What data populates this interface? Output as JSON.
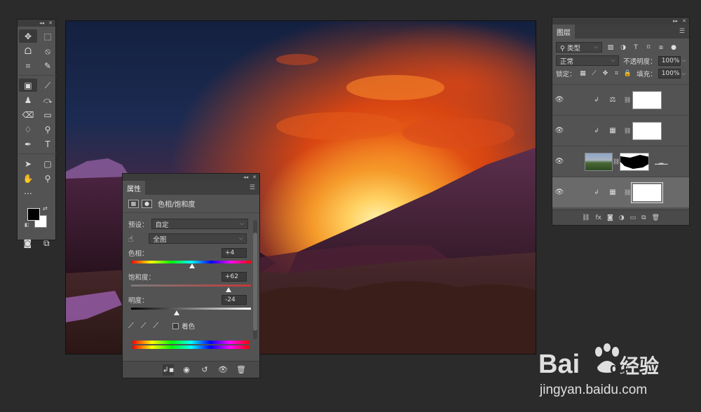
{
  "toolbar": {
    "tools": [
      {
        "name": "move-tool",
        "glyph": "✥",
        "selected": true
      },
      {
        "name": "marquee-tool",
        "glyph": "⬚"
      },
      {
        "name": "lasso-tool",
        "glyph": "ᗝ"
      },
      {
        "name": "quick-select-tool",
        "glyph": "⦸"
      },
      {
        "name": "crop-tool",
        "glyph": "⌗"
      },
      {
        "name": "eyedropper-tool",
        "glyph": "✎"
      },
      {
        "name": "patch-tool",
        "glyph": "▣",
        "selected": true
      },
      {
        "name": "brush-tool",
        "glyph": "⟋"
      },
      {
        "name": "stamp-tool",
        "glyph": "♟"
      },
      {
        "name": "history-brush-tool",
        "glyph": "⤼"
      },
      {
        "name": "eraser-tool",
        "glyph": "⌫"
      },
      {
        "name": "gradient-tool",
        "glyph": "▭"
      },
      {
        "name": "blur-tool",
        "glyph": "♢"
      },
      {
        "name": "dodge-tool",
        "glyph": "⚲"
      },
      {
        "name": "pen-tool",
        "glyph": "✒"
      },
      {
        "name": "type-tool",
        "glyph": "T"
      },
      {
        "name": "path-select-tool",
        "glyph": "➤"
      },
      {
        "name": "shape-tool",
        "glyph": "▢"
      },
      {
        "name": "hand-tool",
        "glyph": "✋"
      },
      {
        "name": "zoom-tool",
        "glyph": "⚲"
      },
      {
        "name": "more-tools",
        "glyph": "⋯"
      }
    ]
  },
  "properties": {
    "tab": "属性",
    "title": "色相/饱和度",
    "preset_label": "预设：",
    "preset_value": "自定",
    "channel_value": "全图",
    "hue_label": "色相：",
    "hue_value": "+4",
    "hue_pct": 0.51,
    "saturation_label": "饱和度：",
    "saturation_value": "+62",
    "saturation_pct": 0.81,
    "lightness_label": "明度：",
    "lightness_value": "-24",
    "lightness_pct": 0.38,
    "colorize_label": "着色"
  },
  "layers": {
    "tab": "图层",
    "filter_label": "类型",
    "blend_mode": "正常",
    "opacity_label": "不透明度：",
    "opacity_value": "100%",
    "lock_label": "锁定：",
    "fill_label": "填充：",
    "fill_value": "100%",
    "items": [
      {
        "adjustment": "balance-icon",
        "clipped": true,
        "selected": false
      },
      {
        "adjustment": "levels-icon",
        "clipped": true,
        "selected": false
      },
      {
        "adjustment": "image",
        "clipped": false,
        "selected": false
      },
      {
        "adjustment": "hue-sat-icon",
        "clipped": true,
        "selected": true
      }
    ]
  },
  "watermark": {
    "brand": "Bai",
    "brand_tail": "du",
    "suffix": "经验",
    "url": "jingyan.baidu.com"
  },
  "colors": {
    "panel": "#535353",
    "panel_dark": "#3c3c3c",
    "workspace": "#2b2b2b"
  }
}
